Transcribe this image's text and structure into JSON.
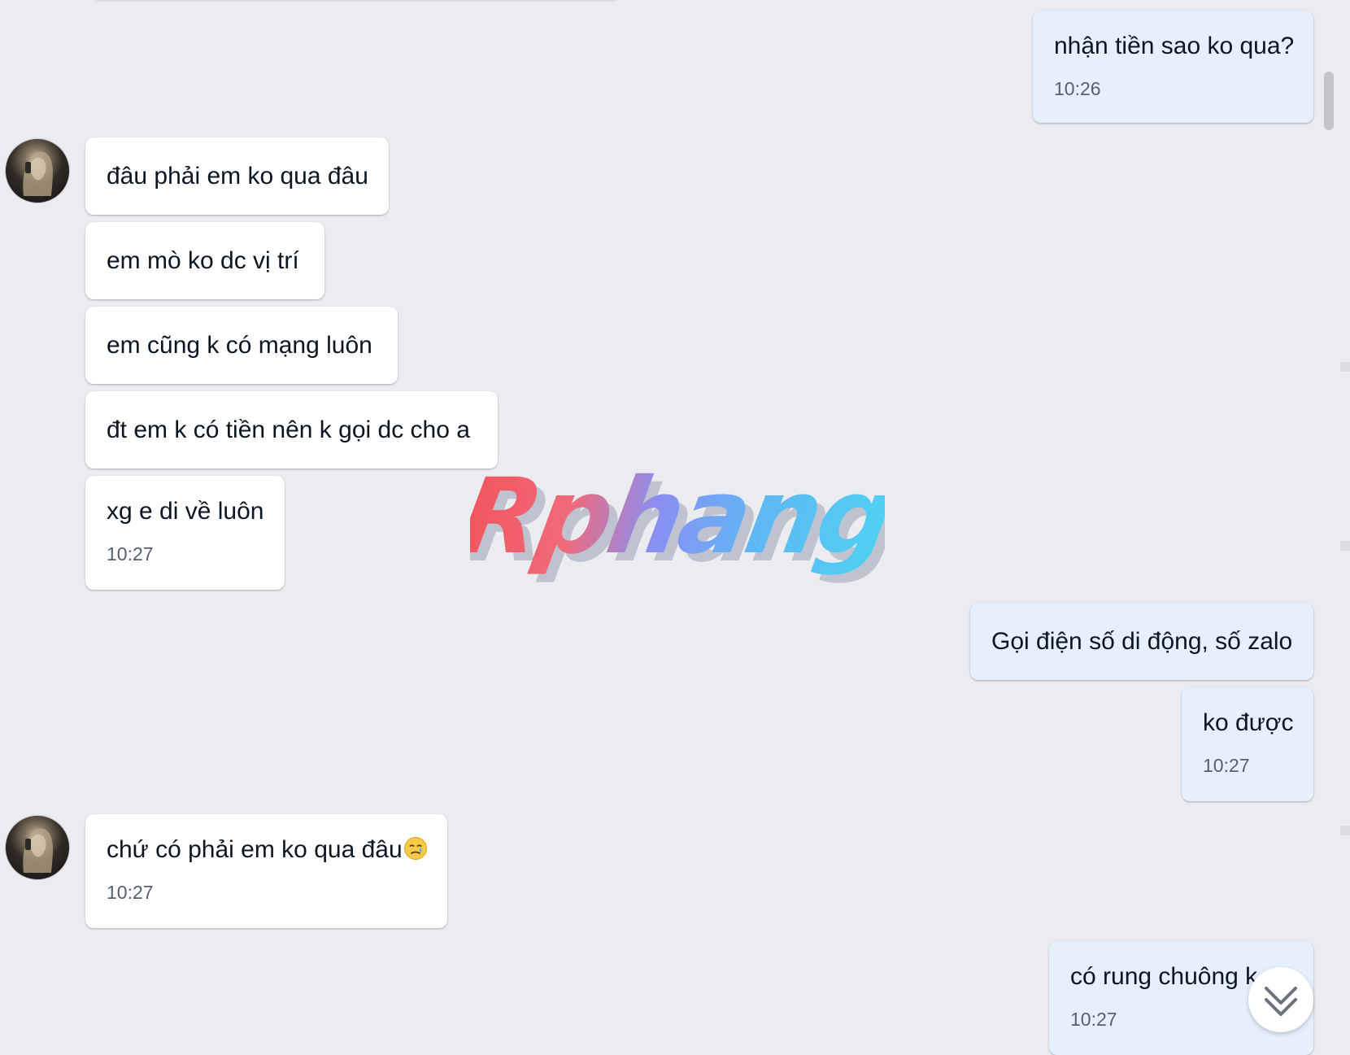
{
  "messages": [
    {
      "id": "m1",
      "side": "out",
      "text": "nhận tiền sao ko qua?",
      "time": "10:26"
    },
    {
      "id": "m2",
      "side": "in",
      "text": "đâu phải em ko qua đâu",
      "time": ""
    },
    {
      "id": "m3",
      "side": "in",
      "text": "em mò ko dc vị trí",
      "time": ""
    },
    {
      "id": "m4",
      "side": "in",
      "text": "em cũng k có mạng luôn",
      "time": ""
    },
    {
      "id": "m5",
      "side": "in",
      "text": "đt em k có tiền nên k gọi dc cho a",
      "time": ""
    },
    {
      "id": "m6",
      "side": "in",
      "text": "xg e di về luôn",
      "time": "10:27"
    },
    {
      "id": "m7",
      "side": "out",
      "text": "Gọi điện số di động, số zalo",
      "time": ""
    },
    {
      "id": "m8",
      "side": "out",
      "text": "ko được",
      "time": "10:27"
    },
    {
      "id": "m9",
      "side": "in",
      "text": "chứ có phải em ko qua đâu",
      "emoji": "crying-face-emoji",
      "time": "10:27"
    },
    {
      "id": "m10",
      "side": "out",
      "text": "có rung chuông k",
      "time": "10:27"
    }
  ],
  "watermark": {
    "text": "Rphang",
    "gradient_start": "#f2545b",
    "gradient_mid": "#7f8cf5",
    "gradient_end": "#4fd1f2"
  },
  "scroll_button": {
    "icon": "double-chevron-down-icon"
  },
  "colors": {
    "background": "#ebecf0",
    "incoming_bubble": "#ffffff",
    "outgoing_bubble": "#e6f0fd",
    "time_text": "#56606e"
  }
}
